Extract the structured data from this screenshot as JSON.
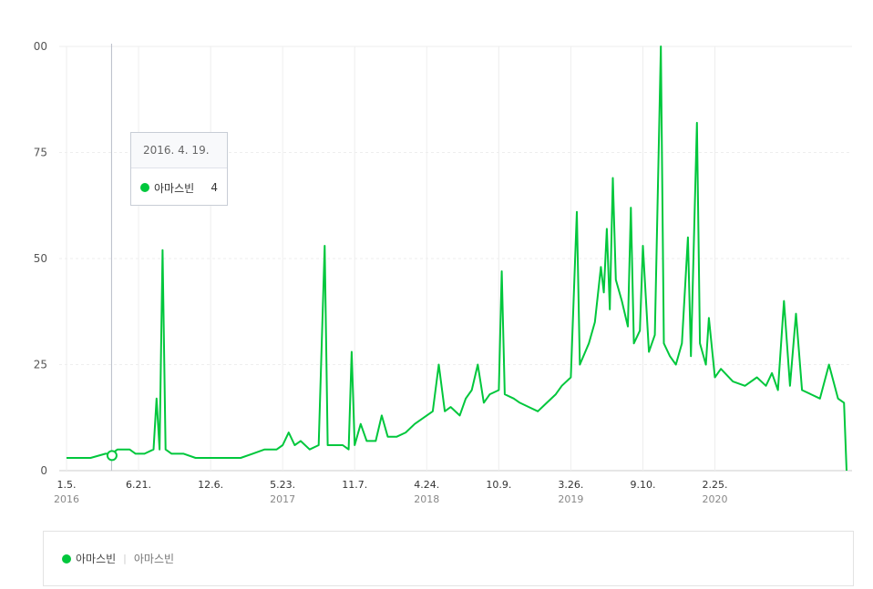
{
  "colors": {
    "series": "#00c73c",
    "grid": "#eeeeee",
    "cursor": "#b8bcc8"
  },
  "tooltip": {
    "date": "2016. 4. 19.",
    "series_name": "아마스빈",
    "value": "4"
  },
  "legend": {
    "label": "아마스빈",
    "sub_label": "아마스빈"
  },
  "chart_data": {
    "type": "line",
    "title": "",
    "xlabel": "",
    "ylabel": "",
    "ylim": [
      0,
      100
    ],
    "y_ticks": [
      "0",
      "25",
      "50",
      "75",
      "00"
    ],
    "x_range": [
      "2016-01-05",
      "2020-12-28"
    ],
    "x_ticks": [
      {
        "label": "1.5.",
        "year": "2016",
        "date": "2016-01-05"
      },
      {
        "label": "6.21.",
        "year": "",
        "date": "2016-06-21"
      },
      {
        "label": "12.6.",
        "year": "",
        "date": "2016-12-06"
      },
      {
        "label": "5.23.",
        "year": "2017",
        "date": "2017-05-23"
      },
      {
        "label": "11.7.",
        "year": "",
        "date": "2017-11-07"
      },
      {
        "label": "4.24.",
        "year": "2018",
        "date": "2018-04-24"
      },
      {
        "label": "10.9.",
        "year": "",
        "date": "2018-10-09"
      },
      {
        "label": "3.26.",
        "year": "2019",
        "date": "2019-03-26"
      },
      {
        "label": "9.10.",
        "year": "",
        "date": "2019-09-10"
      },
      {
        "label": "2.25.",
        "year": "2020",
        "date": "2020-02-25"
      }
    ],
    "grid": true,
    "legend_position": "bottom",
    "highlight": {
      "date": "2016-04-19",
      "value": 4
    },
    "series": [
      {
        "name": "아마스빈",
        "points": [
          [
            "2016-01-05",
            3
          ],
          [
            "2016-02-02",
            3
          ],
          [
            "2016-03-01",
            3
          ],
          [
            "2016-04-05",
            4
          ],
          [
            "2016-04-19",
            4
          ],
          [
            "2016-05-03",
            5
          ],
          [
            "2016-05-31",
            5
          ],
          [
            "2016-06-14",
            4
          ],
          [
            "2016-07-05",
            4
          ],
          [
            "2016-07-26",
            5
          ],
          [
            "2016-08-02",
            17
          ],
          [
            "2016-08-09",
            5
          ],
          [
            "2016-08-16",
            52
          ],
          [
            "2016-08-23",
            5
          ],
          [
            "2016-09-06",
            4
          ],
          [
            "2016-10-04",
            4
          ],
          [
            "2016-11-01",
            3
          ],
          [
            "2016-12-06",
            3
          ],
          [
            "2017-01-10",
            3
          ],
          [
            "2017-02-14",
            3
          ],
          [
            "2017-03-14",
            4
          ],
          [
            "2017-04-11",
            5
          ],
          [
            "2017-05-09",
            5
          ],
          [
            "2017-05-23",
            6
          ],
          [
            "2017-06-06",
            9
          ],
          [
            "2017-06-20",
            6
          ],
          [
            "2017-07-04",
            7
          ],
          [
            "2017-07-25",
            5
          ],
          [
            "2017-08-15",
            6
          ],
          [
            "2017-08-29",
            53
          ],
          [
            "2017-09-05",
            6
          ],
          [
            "2017-10-10",
            6
          ],
          [
            "2017-10-24",
            5
          ],
          [
            "2017-10-31",
            28
          ],
          [
            "2017-11-07",
            6
          ],
          [
            "2017-11-21",
            11
          ],
          [
            "2017-12-05",
            7
          ],
          [
            "2017-12-26",
            7
          ],
          [
            "2018-01-09",
            13
          ],
          [
            "2018-01-23",
            8
          ],
          [
            "2018-02-13",
            8
          ],
          [
            "2018-03-06",
            9
          ],
          [
            "2018-03-27",
            11
          ],
          [
            "2018-04-10",
            12
          ],
          [
            "2018-04-24",
            13
          ],
          [
            "2018-05-08",
            14
          ],
          [
            "2018-05-22",
            25
          ],
          [
            "2018-06-05",
            14
          ],
          [
            "2018-06-19",
            15
          ],
          [
            "2018-07-10",
            13
          ],
          [
            "2018-07-24",
            17
          ],
          [
            "2018-08-07",
            19
          ],
          [
            "2018-08-21",
            25
          ],
          [
            "2018-09-04",
            16
          ],
          [
            "2018-09-18",
            18
          ],
          [
            "2018-10-09",
            19
          ],
          [
            "2018-10-16",
            47
          ],
          [
            "2018-10-23",
            18
          ],
          [
            "2018-11-13",
            17
          ],
          [
            "2018-11-27",
            16
          ],
          [
            "2018-12-18",
            15
          ],
          [
            "2019-01-08",
            14
          ],
          [
            "2019-01-29",
            16
          ],
          [
            "2019-02-19",
            18
          ],
          [
            "2019-03-05",
            20
          ],
          [
            "2019-03-26",
            22
          ],
          [
            "2019-04-09",
            61
          ],
          [
            "2019-04-16",
            25
          ],
          [
            "2019-05-07",
            30
          ],
          [
            "2019-05-21",
            35
          ],
          [
            "2019-06-04",
            48
          ],
          [
            "2019-06-11",
            42
          ],
          [
            "2019-06-18",
            57
          ],
          [
            "2019-06-25",
            38
          ],
          [
            "2019-07-02",
            69
          ],
          [
            "2019-07-09",
            45
          ],
          [
            "2019-07-23",
            40
          ],
          [
            "2019-08-06",
            34
          ],
          [
            "2019-08-13",
            62
          ],
          [
            "2019-08-20",
            30
          ],
          [
            "2019-09-03",
            33
          ],
          [
            "2019-09-10",
            53
          ],
          [
            "2019-09-24",
            28
          ],
          [
            "2019-10-08",
            32
          ],
          [
            "2019-10-22",
            100
          ],
          [
            "2019-10-29",
            30
          ],
          [
            "2019-11-12",
            27
          ],
          [
            "2019-11-26",
            25
          ],
          [
            "2019-12-10",
            30
          ],
          [
            "2019-12-24",
            55
          ],
          [
            "2019-12-31",
            27
          ],
          [
            "2020-01-14",
            82
          ],
          [
            "2020-01-21",
            30
          ],
          [
            "2020-02-04",
            25
          ],
          [
            "2020-02-11",
            36
          ],
          [
            "2020-02-25",
            22
          ],
          [
            "2020-03-10",
            24
          ],
          [
            "2020-04-07",
            21
          ],
          [
            "2020-05-05",
            20
          ],
          [
            "2020-06-02",
            22
          ],
          [
            "2020-06-23",
            20
          ],
          [
            "2020-07-07",
            23
          ],
          [
            "2020-07-21",
            19
          ],
          [
            "2020-08-04",
            40
          ],
          [
            "2020-08-18",
            20
          ],
          [
            "2020-09-01",
            37
          ],
          [
            "2020-09-15",
            19
          ],
          [
            "2020-10-06",
            18
          ],
          [
            "2020-10-27",
            17
          ],
          [
            "2020-11-17",
            25
          ],
          [
            "2020-12-08",
            17
          ],
          [
            "2020-12-22",
            16
          ],
          [
            "2020-12-28",
            0
          ]
        ]
      }
    ]
  }
}
